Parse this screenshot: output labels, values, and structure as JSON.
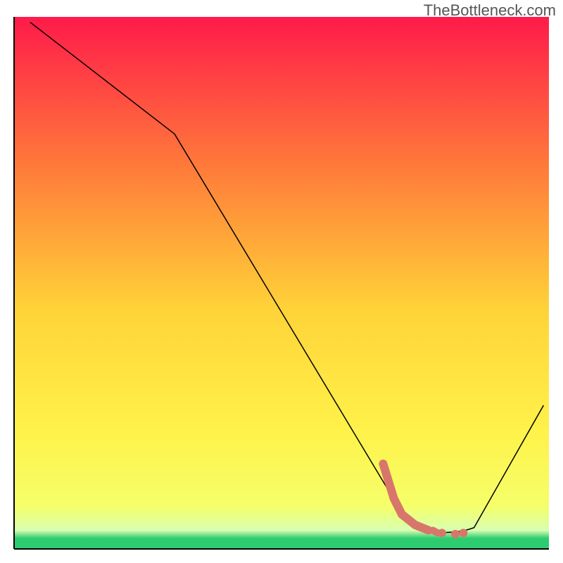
{
  "watermark": "TheBottleneck.com",
  "chart_data": {
    "type": "line",
    "title": "",
    "xlabel": "",
    "ylabel": "",
    "xlim": [
      0,
      100
    ],
    "ylim": [
      0,
      100
    ],
    "gradient_colors": {
      "top": "#ff1a4a",
      "mid1": "#ff7a3a",
      "mid2": "#ffd338",
      "mid3": "#fff24a",
      "mid4": "#f5ff6a",
      "bottom_green": "#2ecc71"
    },
    "series": [
      {
        "name": "bottleneck-curve",
        "color": "#000000",
        "stroke_width": 1.5,
        "points": [
          {
            "x": 3,
            "y": 99
          },
          {
            "x": 30,
            "y": 78
          },
          {
            "x": 70,
            "y": 11
          },
          {
            "x": 72,
            "y": 7
          },
          {
            "x": 76,
            "y": 3.5
          },
          {
            "x": 82,
            "y": 2.5
          },
          {
            "x": 86,
            "y": 4
          },
          {
            "x": 99,
            "y": 27
          }
        ]
      }
    ],
    "highlight_segment": {
      "name": "optimal-range",
      "color": "#d8766b",
      "points": [
        {
          "x": 69,
          "y": 16
        },
        {
          "x": 71,
          "y": 9.5
        },
        {
          "x": 72.5,
          "y": 6.5
        },
        {
          "x": 75,
          "y": 4.5
        },
        {
          "x": 77.5,
          "y": 3.5
        },
        {
          "x": 80,
          "y": 3
        },
        {
          "x": 82.5,
          "y": 2.8
        },
        {
          "x": 84,
          "y": 3
        }
      ]
    }
  }
}
